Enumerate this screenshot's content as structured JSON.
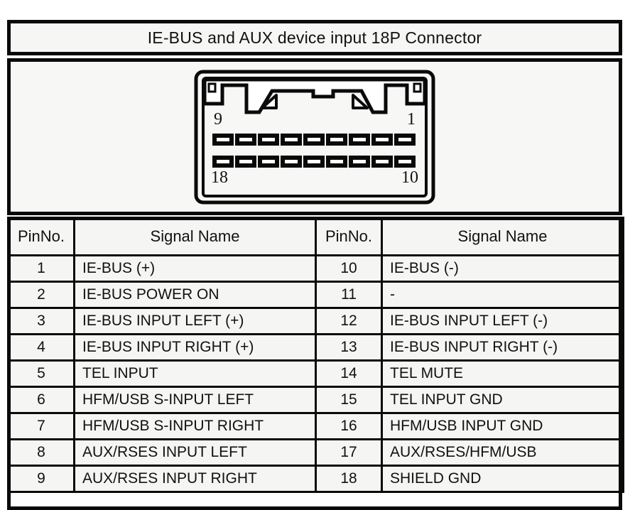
{
  "header": {
    "title": "IE-BUS and AUX device input 18P Connector"
  },
  "diagram": {
    "name": "18P connector face view",
    "top_left_pin": "9",
    "top_right_pin": "1",
    "bottom_left_pin": "18",
    "bottom_right_pin": "10",
    "rows": 2,
    "pins_per_row": 9,
    "total_pins": 18
  },
  "table": {
    "headers": [
      "PinNo.",
      "Signal Name",
      "PinNo.",
      "Signal Name"
    ],
    "rows": [
      {
        "left_pin": "1",
        "left_signal": "IE-BUS (+)",
        "right_pin": "10",
        "right_signal": "IE-BUS (-)"
      },
      {
        "left_pin": "2",
        "left_signal": "IE-BUS POWER ON",
        "right_pin": "11",
        "right_signal": "-"
      },
      {
        "left_pin": "3",
        "left_signal": "IE-BUS INPUT LEFT (+)",
        "right_pin": "12",
        "right_signal": "IE-BUS INPUT LEFT (-)"
      },
      {
        "left_pin": "4",
        "left_signal": "IE-BUS INPUT RIGHT (+)",
        "right_pin": "13",
        "right_signal": "IE-BUS INPUT RIGHT (-)"
      },
      {
        "left_pin": "5",
        "left_signal": "TEL INPUT",
        "right_pin": "14",
        "right_signal": "TEL MUTE"
      },
      {
        "left_pin": "6",
        "left_signal": "HFM/USB S-INPUT LEFT",
        "right_pin": "15",
        "right_signal": "TEL INPUT GND"
      },
      {
        "left_pin": "7",
        "left_signal": "HFM/USB S-INPUT RIGHT",
        "right_pin": "16",
        "right_signal": "HFM/USB INPUT GND"
      },
      {
        "left_pin": "8",
        "left_signal": "AUX/RSES INPUT LEFT",
        "right_pin": "17",
        "right_signal": "AUX/RSES/HFM/USB"
      },
      {
        "left_pin": "9",
        "left_signal": "AUX/RSES INPUT RIGHT",
        "right_pin": "18",
        "right_signal": "SHIELD GND"
      }
    ]
  },
  "colors": {
    "line": "#0a0a0a",
    "cell_background": "#f5f5f3",
    "panel_background": "#f7f7f5",
    "text": "#111111",
    "page_background": "#ffffff"
  }
}
